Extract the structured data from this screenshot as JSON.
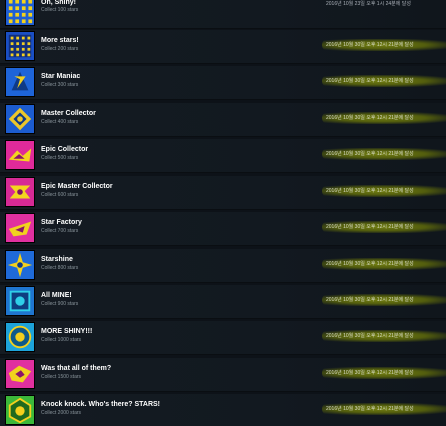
{
  "achievements": [
    {
      "title": "Oh, Shiny!",
      "desc": "Collect 100 stars",
      "date": "2016년 10월 23일 오후 1시 24분에 달성",
      "icon": "yellow-grid-icon",
      "colors": {
        "bg": "#1f5fd6",
        "fg": "#f4d21b",
        "bg2": "#153f96"
      }
    },
    {
      "title": "More stars!",
      "desc": "Collect 200 stars",
      "date": "2016년 10월 30일 오후 12시 21분에 달성",
      "icon": "blue-grid-icon",
      "colors": {
        "bg": "#1a4fc4",
        "fg": "#f1cf23",
        "bg2": "#102f7c"
      }
    },
    {
      "title": "Star Maniac",
      "desc": "Collect 300 stars",
      "date": "2016년 10월 30일 오후 12시 21분에 달성",
      "icon": "star-maniac-icon",
      "colors": {
        "bg": "#1e64d8",
        "fg": "#f3d01d",
        "bg2": "#0f3a86"
      }
    },
    {
      "title": "Master Collector",
      "desc": "Collect 400 stars",
      "date": "2016년 10월 30일 오후 12시 21분에 달성",
      "icon": "master-collector-icon",
      "colors": {
        "bg": "#1c5ccf",
        "fg": "#ecc72a",
        "bg2": "#0f3a86"
      }
    },
    {
      "title": "Epic Collector",
      "desc": "Collect 500 stars",
      "date": "2016년 10월 30일 오후 12시 21분에 달성",
      "icon": "epic-collector-icon",
      "colors": {
        "bg": "#e02a9a",
        "fg": "#f3d51e",
        "bg2": "#8b1468"
      }
    },
    {
      "title": "Epic Master Collector",
      "desc": "Collect 600 stars",
      "date": "2016년 10월 30일 오후 12시 21분에 달성",
      "icon": "epic-master-collector-icon",
      "colors": {
        "bg": "#d72a95",
        "fg": "#f3d51e",
        "bg2": "#7d1262"
      }
    },
    {
      "title": "Star Factory",
      "desc": "Collect 700 stars",
      "date": "2016년 10월 30일 오후 12시 21분에 달성",
      "icon": "star-factory-icon",
      "colors": {
        "bg": "#e0309f",
        "fg": "#f1d21e",
        "bg2": "#8b1468"
      }
    },
    {
      "title": "Starshine",
      "desc": "Collect 800 stars",
      "date": "2016년 10월 30일 오후 12시 21분에 달성",
      "icon": "starshine-icon",
      "colors": {
        "bg": "#1f6ad8",
        "fg": "#f3d01d",
        "bg2": "#0f3a86"
      }
    },
    {
      "title": "All MINE!",
      "desc": "Collect 900 stars",
      "date": "2016년 10월 30일 오후 12시 21분에 달성",
      "icon": "all-mine-icon",
      "colors": {
        "bg": "#1f76d0",
        "fg": "#2fd0e8",
        "bg2": "#0e3f80"
      }
    },
    {
      "title": "MORE SHINY!!!",
      "desc": "Collect 1000 stars",
      "date": "2016년 10월 30일 오후 12시 21분에 달성",
      "icon": "more-shiny-icon",
      "colors": {
        "bg": "#1da3d9",
        "fg": "#f3d01d",
        "bg2": "#0e5a8a"
      }
    },
    {
      "title": "Was that all of them?",
      "desc": "Collect 1500 stars",
      "date": "2016년 10월 30일 오후 12시 21분에 달성",
      "icon": "was-that-all-icon",
      "colors": {
        "bg": "#e0309f",
        "fg": "#f1d21e",
        "bg2": "#8b1468"
      }
    },
    {
      "title": "Knock knock. Who's there? STARS!",
      "desc": "Collect 2000 stars",
      "date": "2016년 10월 30일 오후 12시 21분에 달성",
      "icon": "knock-knock-icon",
      "colors": {
        "bg": "#3cb83a",
        "fg": "#f3d01d",
        "bg2": "#1e6a1e"
      }
    }
  ]
}
